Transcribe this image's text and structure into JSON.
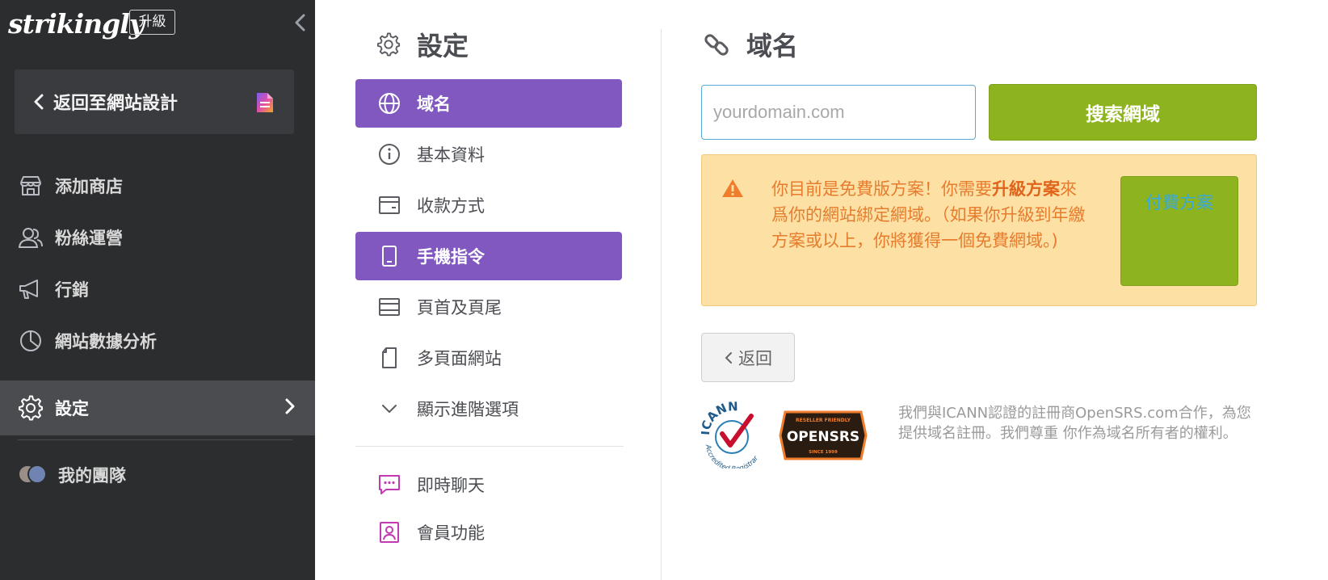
{
  "sidebar": {
    "logo": "strikingly",
    "upgrade_label": "升級",
    "back_to_design": "返回至網站設計",
    "items": [
      {
        "label": "添加商店",
        "icon": "store-icon"
      },
      {
        "label": "粉絲運營",
        "icon": "users-icon"
      },
      {
        "label": "行銷",
        "icon": "megaphone-icon"
      },
      {
        "label": "網站數據分析",
        "icon": "pie-chart-icon"
      },
      {
        "label": "設定",
        "icon": "gear-icon",
        "active": true
      },
      {
        "label": "我的團隊",
        "icon": "team-avatars"
      }
    ]
  },
  "settings": {
    "title": "設定",
    "items": [
      {
        "label": "域名",
        "icon": "globe-icon",
        "active": true
      },
      {
        "label": "基本資料",
        "icon": "info-icon"
      },
      {
        "label": "收款方式",
        "icon": "wallet-icon"
      },
      {
        "label": "手機指令",
        "icon": "mobile-icon",
        "active": true
      },
      {
        "label": "頁首及頁尾",
        "icon": "layout-icon"
      },
      {
        "label": "多頁面網站",
        "icon": "pages-icon"
      },
      {
        "label": "顯示進階選項",
        "icon": "chevron-down-icon"
      }
    ],
    "extra_items": [
      {
        "label": "即時聊天",
        "icon": "chat-icon"
      },
      {
        "label": "會員功能",
        "icon": "member-icon"
      }
    ]
  },
  "domain": {
    "title": "域名",
    "input_placeholder": "yourdomain.com",
    "input_value": "",
    "search_button": "搜索網域",
    "notice_part1": "你目前是免費版方案！你需要",
    "notice_bold": "升級方案",
    "notice_part2": "來爲你的網站綁定網域。（如果你升級到年繳方案或以上，你將獲得一個免費網域。)",
    "paid_button": "付費方案",
    "back_button": "返回",
    "icann_label": "ICANN",
    "icann_sub": "Accredited Registrar",
    "opensrs_label": "OPENSRS",
    "opensrs_top": "RESELLER FRIENDLY",
    "opensrs_bottom": "SINCE 1999",
    "registrar_note": "我們與ICANN認證的註冊商OpenSRS.com合作，為您提供域名註冊。我們尊重 你作為域名所有者的權利。"
  },
  "colors": {
    "sidebar_bg": "#2c2d2f",
    "accent_purple": "#8158bf",
    "accent_green": "#8db31f",
    "warning_bg": "#fde1a4",
    "warning_text": "#e67c2e",
    "link_blue": "#38a8e0"
  }
}
